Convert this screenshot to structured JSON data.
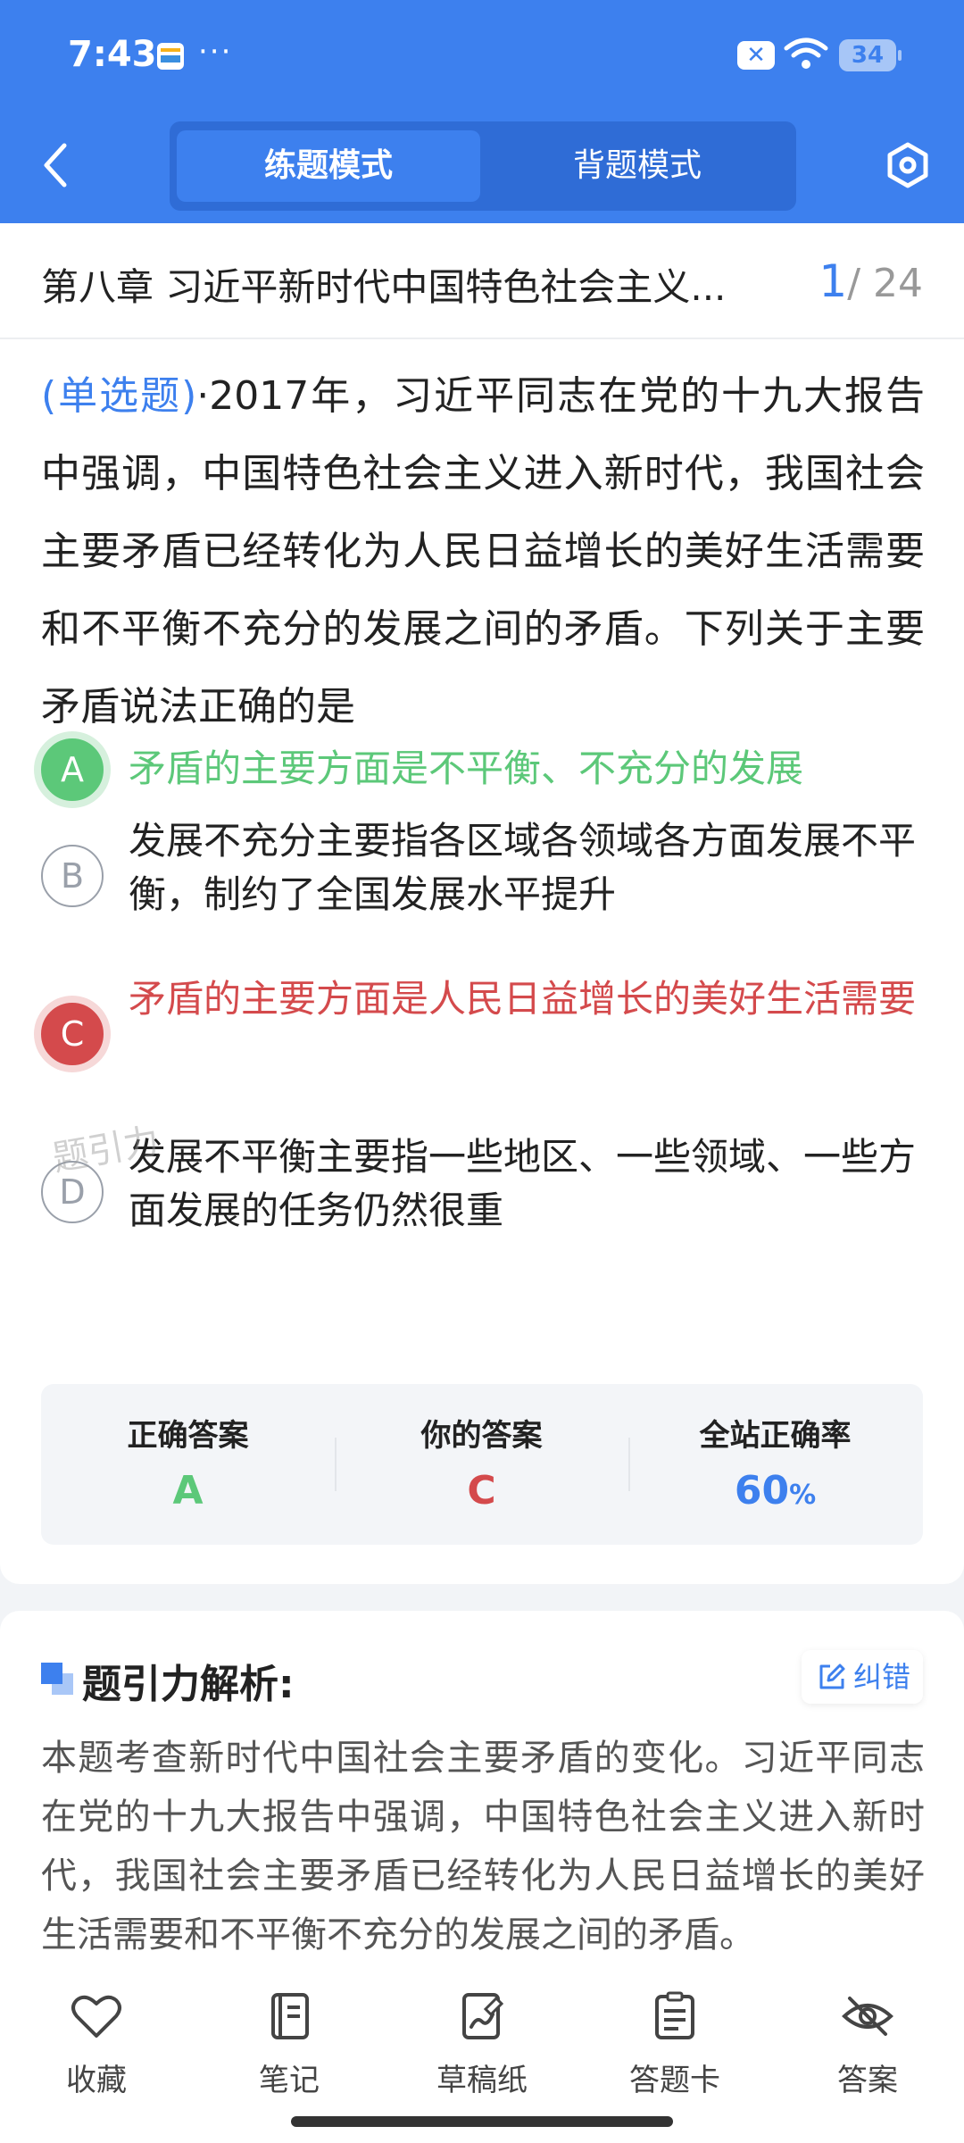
{
  "status_bar": {
    "time": "7:43",
    "dots": "···",
    "battery": "34"
  },
  "header": {
    "tabs": [
      {
        "label": "练题模式",
        "active": true
      },
      {
        "label": "背题模式",
        "active": false
      }
    ]
  },
  "question": {
    "chapter": "第八章 习近平新时代中国特色社会主义...",
    "current": "1",
    "total": "/ 24",
    "type": "(单选题)",
    "text": "·2017年，习近平同志在党的十九大报告中强调，中国特色社会主义进入新时代，我国社会主要矛盾已经转化为人民日益增长的美好生活需要和不平衡不充分的发展之间的矛盾。下列关于主要矛盾说法正确的是",
    "options": [
      {
        "key": "A",
        "text": "矛盾的主要方面是不平衡、不充分的发展",
        "state": "correct"
      },
      {
        "key": "B",
        "text": "发展不充分主要指各区域各领域各方面发展不平衡，制约了全国发展水平提升",
        "state": "normal"
      },
      {
        "key": "C",
        "text": "矛盾的主要方面是人民日益增长的美好生活需要",
        "state": "wrong"
      },
      {
        "key": "D",
        "text": "发展不平衡主要指一些地区、一些领域、一些方面发展的任务仍然很重",
        "state": "normal"
      }
    ],
    "watermark": "题引力"
  },
  "answer_summary": {
    "correct_label": "正确答案",
    "correct_value": "A",
    "yours_label": "你的答案",
    "yours_value": "C",
    "rate_label": "全站正确率",
    "rate_value": "60",
    "rate_unit": "%"
  },
  "analysis": {
    "title": "题引力解析:",
    "report_label": "纠错",
    "text": "本题考查新时代中国社会主要矛盾的变化。习近平同志在党的十九大报告中强调，中国特色社会主义进入新时代，我国社会主要矛盾已经转化为人民日益增长的美好生活需要和不平衡不充分的发展之间的矛盾。"
  },
  "bottom_nav": [
    {
      "label": "收藏",
      "icon": "heart-icon"
    },
    {
      "label": "笔记",
      "icon": "notebook-icon"
    },
    {
      "label": "草稿纸",
      "icon": "draft-paper-icon"
    },
    {
      "label": "答题卡",
      "icon": "answer-card-icon"
    },
    {
      "label": "答案",
      "icon": "eye-off-icon"
    }
  ],
  "colors": {
    "primary": "#3d80ee",
    "correct": "#5cc879",
    "wrong": "#d44a4c"
  }
}
